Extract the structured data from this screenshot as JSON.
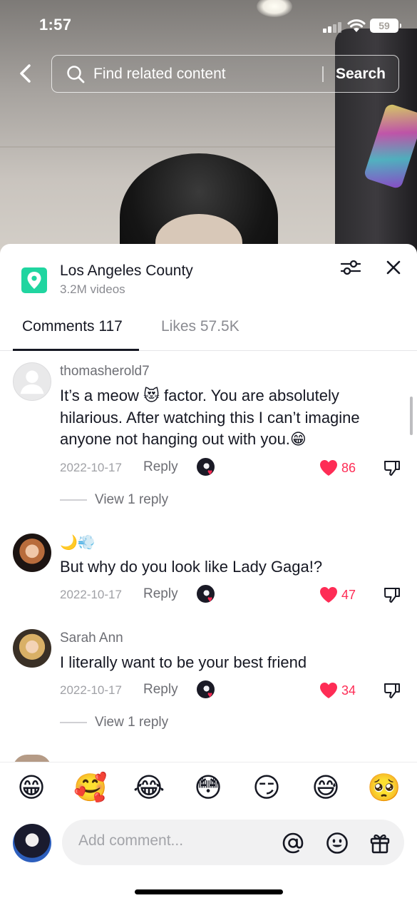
{
  "status_bar": {
    "time": "1:57",
    "battery": "59"
  },
  "search": {
    "placeholder": "Find related content",
    "button": "Search"
  },
  "location": {
    "title": "Los Angeles County",
    "subtitle": "3.2M videos",
    "accent": "#20d5a0"
  },
  "tabs": {
    "comments": "Comments 117",
    "likes": "Likes 57.5K"
  },
  "comments": [
    {
      "user": "thomasherold7",
      "text": "It’s a meow 😻 factor. You are absolutely hilarious. After watching this I can’t imagine anyone not hanging out with you.😁",
      "date": "2022-10-17",
      "reply_label": "Reply",
      "likes": "86",
      "view_replies": "View 1 reply"
    },
    {
      "user": "🌙💨",
      "text": "But why do you look like Lady Gaga!?",
      "date": "2022-10-17",
      "reply_label": "Reply",
      "likes": "47"
    },
    {
      "user": "Sarah Ann",
      "text": "I literally want to be your best friend",
      "date": "2022-10-17",
      "reply_label": "Reply",
      "likes": "34",
      "view_replies": "View 1 reply"
    }
  ],
  "emoji_bar": [
    "😁",
    "🥰",
    "😂",
    "😳",
    "😏",
    "😅",
    "🥺"
  ],
  "composer": {
    "placeholder": "Add comment..."
  },
  "colors": {
    "like": "#fe2c55",
    "text": "#161823",
    "muted": "#8a8b91"
  }
}
